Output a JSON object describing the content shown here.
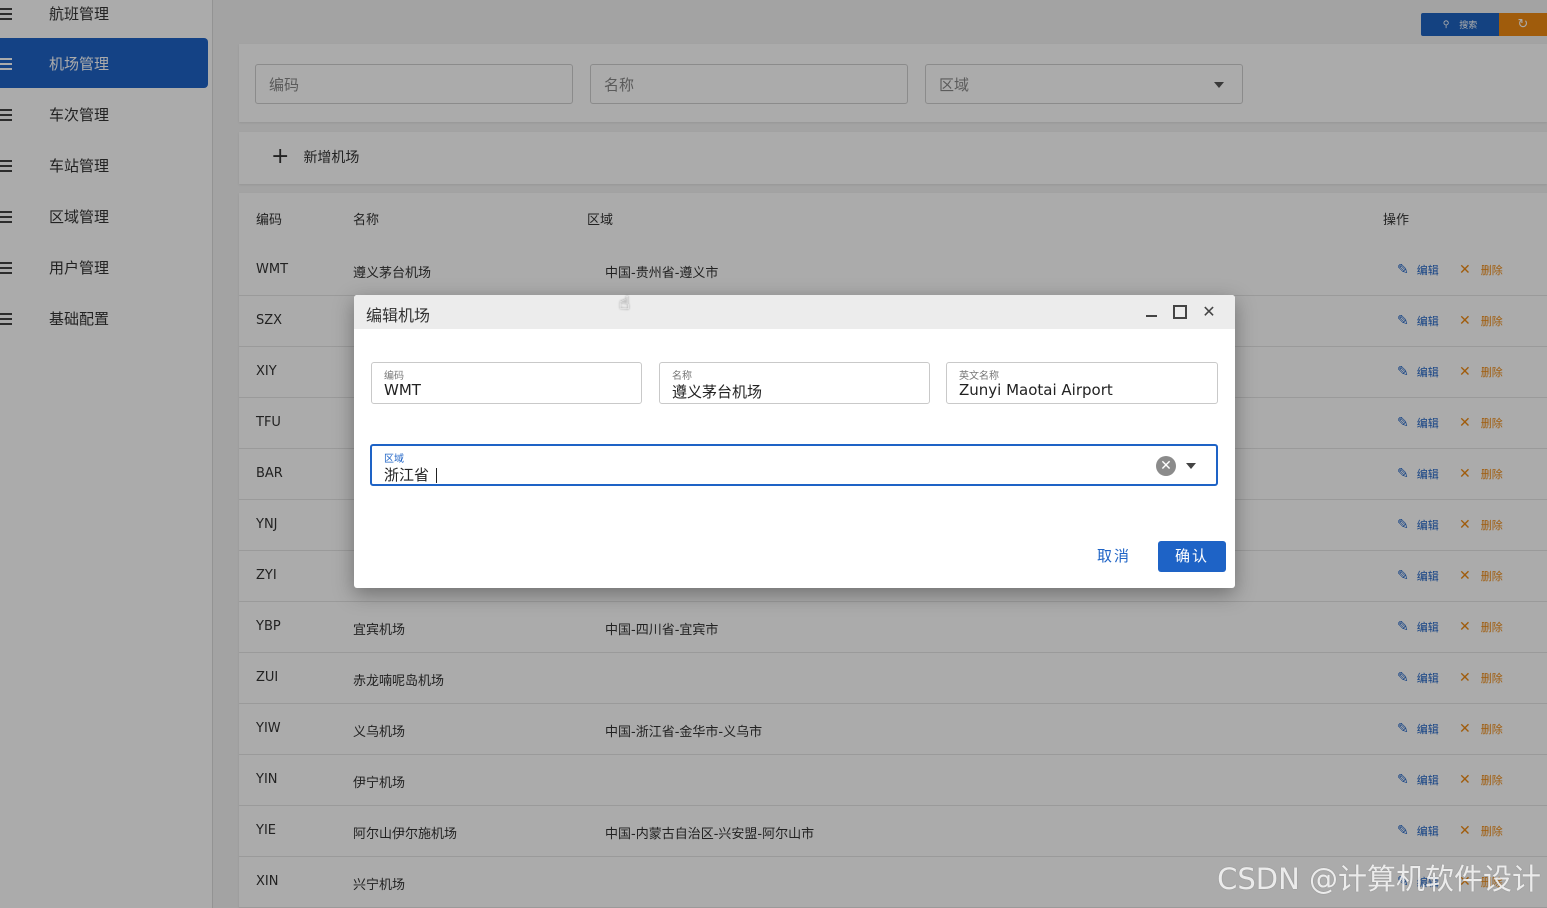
{
  "sidebar": {
    "items": [
      {
        "label": "航班管理",
        "active": false
      },
      {
        "label": "机场管理",
        "active": true
      },
      {
        "label": "车次管理",
        "active": false
      },
      {
        "label": "车站管理",
        "active": false
      },
      {
        "label": "区域管理",
        "active": false
      },
      {
        "label": "用户管理",
        "active": false
      },
      {
        "label": "基础配置",
        "active": false
      }
    ]
  },
  "toolbar": {
    "search_label": "搜索",
    "search_icon": "search-icon",
    "refresh_icon": "refresh-icon"
  },
  "filters": {
    "code_placeholder": "编码",
    "name_placeholder": "名称",
    "area_placeholder": "区域"
  },
  "add_button": {
    "label": "新增机场"
  },
  "table": {
    "headers": {
      "code": "编码",
      "name": "名称",
      "area": "区域",
      "actions": "操作"
    },
    "edit_label": "编辑",
    "delete_label": "删除",
    "rows": [
      {
        "code": "WMT",
        "name": "遵义茅台机场",
        "area": "中国-贵州省-遵义市"
      },
      {
        "code": "SZX",
        "name": "",
        "area": ""
      },
      {
        "code": "XIY",
        "name": "",
        "area": ""
      },
      {
        "code": "TFU",
        "name": "",
        "area": ""
      },
      {
        "code": "BAR",
        "name": "",
        "area": ""
      },
      {
        "code": "YNJ",
        "name": "",
        "area": ""
      },
      {
        "code": "ZYI",
        "name": "",
        "area": ""
      },
      {
        "code": "YBP",
        "name": "宜宾机场",
        "area": "中国-四川省-宜宾市"
      },
      {
        "code": "ZUI",
        "name": "赤龙喃呢岛机场",
        "area": ""
      },
      {
        "code": "YIW",
        "name": "义乌机场",
        "area": "中国-浙江省-金华市-义乌市"
      },
      {
        "code": "YIN",
        "name": "伊宁机场",
        "area": ""
      },
      {
        "code": "YIE",
        "name": "阿尔山伊尔施机场",
        "area": "中国-内蒙古自治区-兴安盟-阿尔山市"
      },
      {
        "code": "XIN",
        "name": "兴宁机场",
        "area": ""
      }
    ]
  },
  "dialog": {
    "title": "编辑机场",
    "code": {
      "label": "编码",
      "value": "WMT"
    },
    "name": {
      "label": "名称",
      "value": "遵义茅台机场"
    },
    "english_name": {
      "label": "英文名称",
      "value": "Zunyi Maotai Airport"
    },
    "area": {
      "label": "区域",
      "value": "浙江省 "
    },
    "cancel_label": "取消",
    "confirm_label": "确认"
  },
  "watermark": "CSDN @计算机软件设计",
  "colors": {
    "primary": "#1e63c6",
    "warning": "#ef8a12"
  }
}
